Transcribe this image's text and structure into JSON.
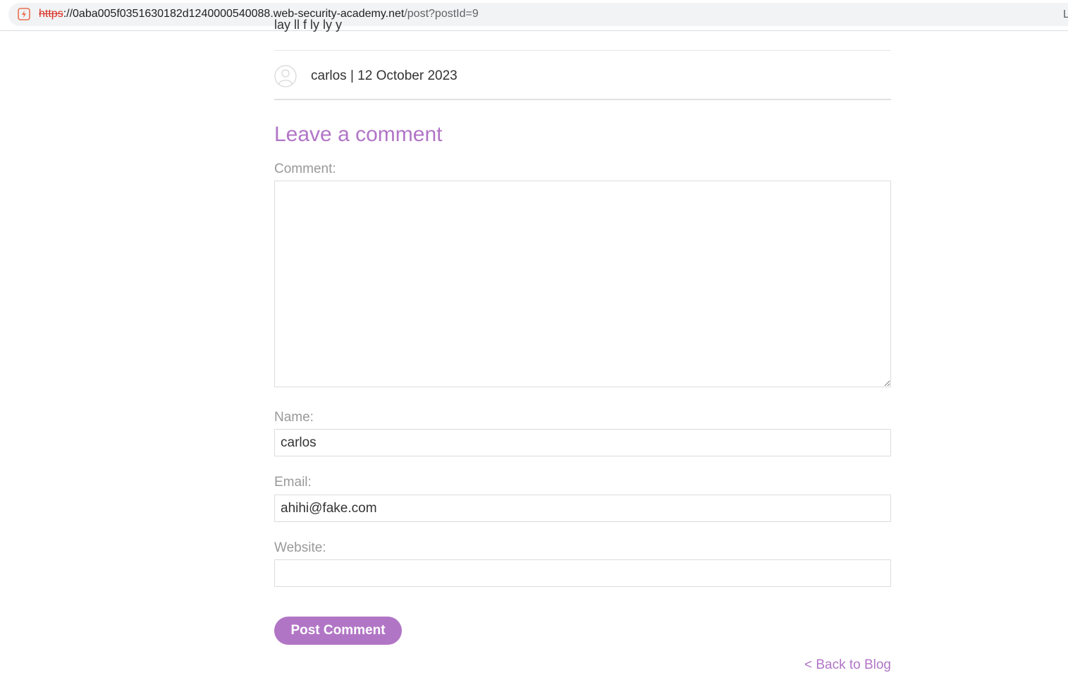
{
  "browser": {
    "url_scheme": "https",
    "url_host": "://0aba005f0351630182d1240000540088.web-security-academy.net",
    "url_path": "/post?postId=9",
    "url_edge_glyph": "L"
  },
  "post": {
    "cutoff_text": "lay  ll       f        ly       ly    y",
    "comment_author_line": "carlos | 12 October 2023"
  },
  "form": {
    "heading": "Leave a comment",
    "comment_label": "Comment:",
    "comment_value": "",
    "name_label": "Name:",
    "name_value": "carlos",
    "email_label": "Email:",
    "email_value": "ahihi@fake.com",
    "website_label": "Website:",
    "website_value": "",
    "submit_label": "Post Comment"
  },
  "nav": {
    "back_label": "< Back to Blog"
  },
  "colors": {
    "accent": "#b175c6",
    "insecure": "#d93025"
  }
}
